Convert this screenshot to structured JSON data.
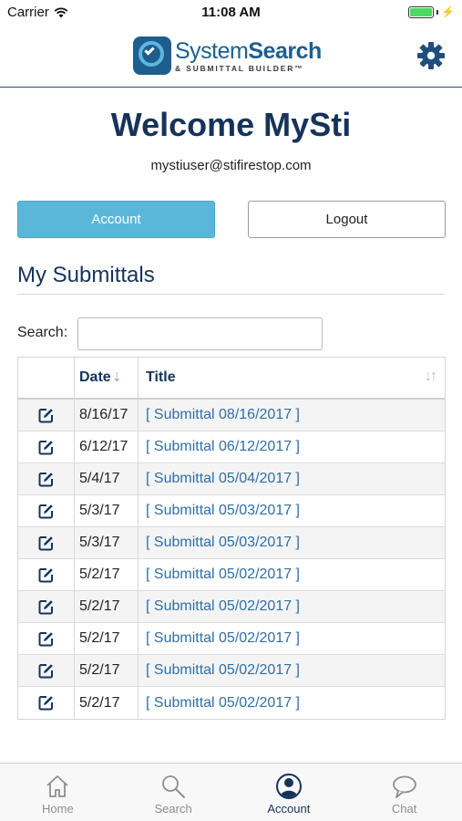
{
  "status_bar": {
    "carrier": "Carrier",
    "time": "11:08 AM"
  },
  "header": {
    "logo_title_light": "System",
    "logo_title_bold": "Search",
    "logo_subtitle": "& SUBMITTAL BUILDER™",
    "settings_icon": "gear-icon"
  },
  "welcome": {
    "title": "Welcome MySti",
    "email": "mystiuser@stifirestop.com"
  },
  "buttons": {
    "account": "Account",
    "logout": "Logout"
  },
  "submittals": {
    "section_title": "My Submittals",
    "search_label": "Search:",
    "search_value": "",
    "columns": [
      "",
      "Date",
      "Title"
    ],
    "rows": [
      {
        "date": "8/16/17",
        "title": "[ Submittal 08/16/2017 ]"
      },
      {
        "date": "6/12/17",
        "title": "[ Submittal 06/12/2017 ]"
      },
      {
        "date": "5/4/17",
        "title": "[ Submittal 05/04/2017 ]"
      },
      {
        "date": "5/3/17",
        "title": "[ Submittal 05/03/2017 ]"
      },
      {
        "date": "5/3/17",
        "title": "[ Submittal 05/03/2017 ]"
      },
      {
        "date": "5/2/17",
        "title": "[ Submittal 05/02/2017 ]"
      },
      {
        "date": "5/2/17",
        "title": "[ Submittal 05/02/2017 ]"
      },
      {
        "date": "5/2/17",
        "title": "[ Submittal 05/02/2017 ]"
      },
      {
        "date": "5/2/17",
        "title": "[ Submittal 05/02/2017 ]"
      },
      {
        "date": "5/2/17",
        "title": "[ Submittal 05/02/2017 ]"
      }
    ]
  },
  "tabbar": {
    "tabs": [
      {
        "label": "Home",
        "icon": "home-icon",
        "active": false
      },
      {
        "label": "Search",
        "icon": "search-icon",
        "active": false
      },
      {
        "label": "Account",
        "icon": "account-icon",
        "active": true
      },
      {
        "label": "Chat",
        "icon": "chat-icon",
        "active": false
      }
    ]
  },
  "colors": {
    "brand_navy": "#16335a",
    "brand_blue": "#1e5e8e",
    "accent_button": "#5bb7da",
    "link": "#2f6fa8"
  }
}
